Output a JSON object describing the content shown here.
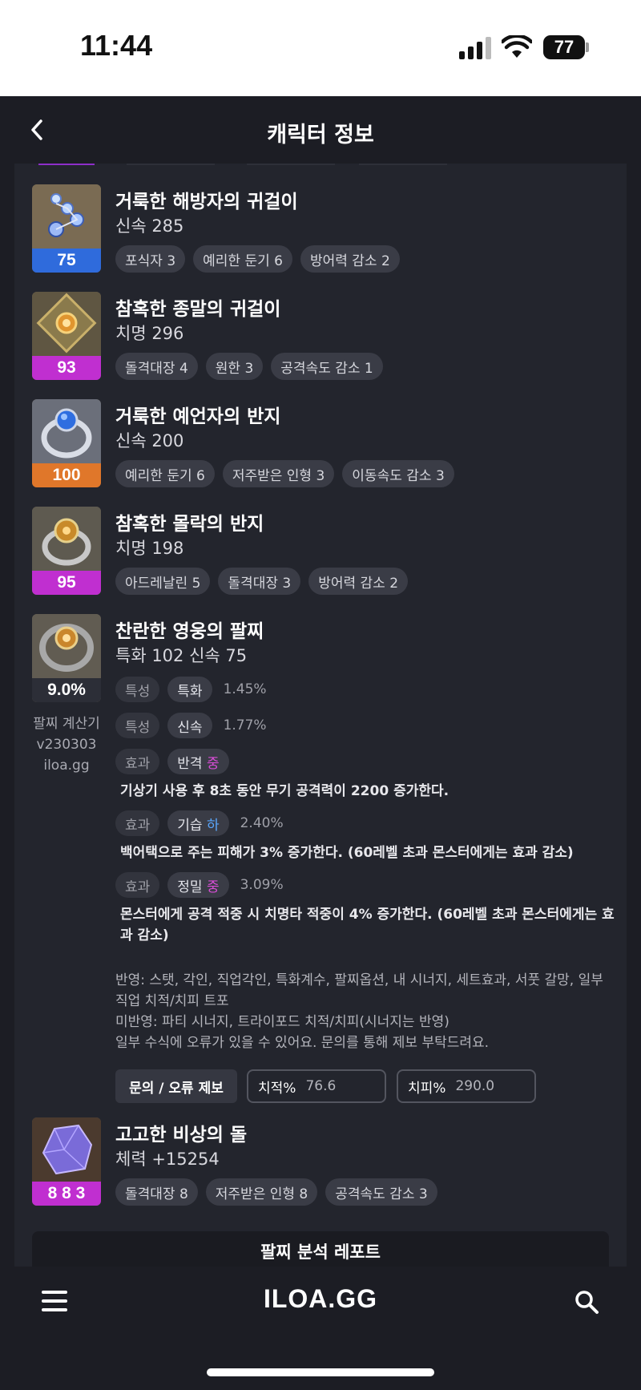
{
  "status_bar": {
    "time": "11:44",
    "battery": "77"
  },
  "header": {
    "title": "캐릭터 정보"
  },
  "accessories": [
    {
      "name": "거룩한 해방자의 귀걸이",
      "stat": "신속 285",
      "quality": "75",
      "quality_color": "#2f6bdc",
      "tags": [
        "포식자 3",
        "예리한 둔기 6",
        "방어력 감소 2"
      ]
    },
    {
      "name": "참혹한 종말의 귀걸이",
      "stat": "치명 296",
      "quality": "93",
      "quality_color": "#c02fd0",
      "tags": [
        "돌격대장 4",
        "원한 3",
        "공격속도 감소 1"
      ]
    },
    {
      "name": "거룩한 예언자의 반지",
      "stat": "신속 200",
      "quality": "100",
      "quality_color": "#e0772a",
      "tags": [
        "예리한 둔기 6",
        "저주받은 인형 3",
        "이동속도 감소 3"
      ]
    },
    {
      "name": "참혹한 몰락의 반지",
      "stat": "치명 198",
      "quality": "95",
      "quality_color": "#c02fd0",
      "tags": [
        "아드레날린 5",
        "돌격대장 3",
        "방어력 감소 2"
      ]
    }
  ],
  "bracelet": {
    "name": "찬란한 영웅의 팔찌",
    "stat": "특화 102  신속 75",
    "badge": "9.0%",
    "calc_line1": "팔찌 계산기",
    "calc_line2": "v230303",
    "calc_line3": "iloa.gg",
    "traits": [
      {
        "kind": "특성",
        "name": "특화",
        "pct": "1.45%"
      },
      {
        "kind": "특성",
        "name": "신속",
        "pct": "1.77%"
      }
    ],
    "effects": [
      {
        "kind": "효과",
        "name": "반격",
        "grade": "중",
        "pct": "",
        "desc": "기상기 사용 후 8초 동안 무기 공격력이 2200 증가한다."
      },
      {
        "kind": "효과",
        "name": "기습",
        "grade": "하",
        "pct": "2.40%",
        "desc": "백어택으로 주는 피해가 3% 증가한다. (60레벨 초과 몬스터에게는 효과 감소)"
      },
      {
        "kind": "효과",
        "name": "정밀",
        "grade": "중",
        "pct": "3.09%",
        "desc": "몬스터에게 공격 적중 시 치명타 적중이 4% 증가한다. (60레벨 초과 몬스터에게는 효과 감소)"
      }
    ],
    "note_applied": "반영: 스탯, 각인, 직업각인, 특화계수, 팔찌옵션, 내 시너지, 세트효과, 서풋 갈망, 일부 직업 치적/치피 트포",
    "note_unapplied": "미반영: 파티 시너지, 트라이포드 치적/치피(시너지는 반영)",
    "note_error": "일부 수식에 오류가 있을 수 있어요. 문의를 통해 제보 부탁드려요.",
    "report_label": "문의 / 오류 제보",
    "crit_rate_label": "치적%",
    "crit_rate_value": "76.6",
    "crit_dmg_label": "치피%",
    "crit_dmg_value": "290.0"
  },
  "stone": {
    "name": "고고한 비상의 돌",
    "stat": "체력 +15254",
    "badge": "8 8 3",
    "quality_color": "#c02fd0",
    "tags": [
      "돌격대장 8",
      "저주받은 인형 8",
      "공격속도 감소 3"
    ]
  },
  "analysis_button": "팔찌 분석 레포트",
  "nav": {
    "logo": "ILOA.GG"
  }
}
